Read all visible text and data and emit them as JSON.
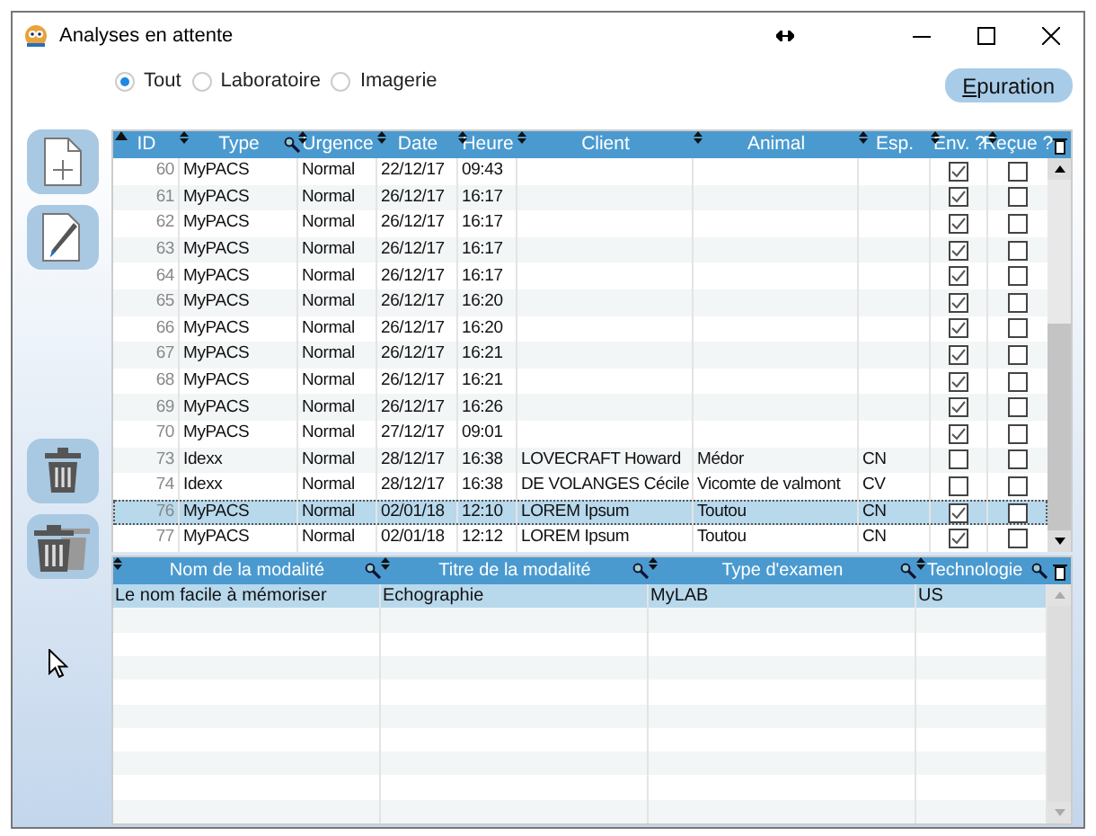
{
  "window": {
    "title": "Analyses en attente"
  },
  "filters": [
    {
      "label": "Tout",
      "selected": true
    },
    {
      "label": "Laboratoire",
      "selected": false
    },
    {
      "label": "Imagerie",
      "selected": false
    }
  ],
  "purge_button": "Epuration",
  "table": {
    "columns": [
      "ID",
      "Type",
      "Urgence",
      "Date",
      "Heure",
      "Client",
      "Animal",
      "Esp.",
      "Env. ?",
      "Reçue ?"
    ],
    "rows": [
      {
        "id": "60",
        "type": "MyPACS",
        "urgence": "Normal",
        "date": "22/12/17",
        "heure": "09:43",
        "env": true,
        "recue": false,
        "selected": false
      },
      {
        "id": "61",
        "type": "MyPACS",
        "urgence": "Normal",
        "date": "26/12/17",
        "heure": "16:17",
        "env": true,
        "recue": false,
        "selected": false
      },
      {
        "id": "62",
        "type": "MyPACS",
        "urgence": "Normal",
        "date": "26/12/17",
        "heure": "16:17",
        "env": true,
        "recue": false,
        "selected": false
      },
      {
        "id": "63",
        "type": "MyPACS",
        "urgence": "Normal",
        "date": "26/12/17",
        "heure": "16:17",
        "env": true,
        "recue": false,
        "selected": false
      },
      {
        "id": "64",
        "type": "MyPACS",
        "urgence": "Normal",
        "date": "26/12/17",
        "heure": "16:17",
        "env": true,
        "recue": false,
        "selected": false
      },
      {
        "id": "65",
        "type": "MyPACS",
        "urgence": "Normal",
        "date": "26/12/17",
        "heure": "16:20",
        "env": true,
        "recue": false,
        "selected": false
      },
      {
        "id": "66",
        "type": "MyPACS",
        "urgence": "Normal",
        "date": "26/12/17",
        "heure": "16:20",
        "env": true,
        "recue": false,
        "selected": false
      },
      {
        "id": "67",
        "type": "MyPACS",
        "urgence": "Normal",
        "date": "26/12/17",
        "heure": "16:21",
        "env": true,
        "recue": false,
        "selected": false
      },
      {
        "id": "68",
        "type": "MyPACS",
        "urgence": "Normal",
        "date": "26/12/17",
        "heure": "16:21",
        "env": true,
        "recue": false,
        "selected": false
      },
      {
        "id": "69",
        "type": "MyPACS",
        "urgence": "Normal",
        "date": "26/12/17",
        "heure": "16:26",
        "env": true,
        "recue": false,
        "selected": false
      },
      {
        "id": "70",
        "type": "MyPACS",
        "urgence": "Normal",
        "date": "27/12/17",
        "heure": "09:01",
        "env": true,
        "recue": false,
        "selected": false
      },
      {
        "id": "73",
        "type": "Idexx",
        "urgence": "Normal",
        "date": "28/12/17",
        "heure": "16:38",
        "client": "LOVECRAFT Howard",
        "animal": "Médor",
        "esp": "CN",
        "env": false,
        "recue": false,
        "selected": false
      },
      {
        "id": "74",
        "type": "Idexx",
        "urgence": "Normal",
        "date": "28/12/17",
        "heure": "16:38",
        "client": "DE VOLANGES Cécile",
        "animal": "Vicomte de valmont",
        "esp": "CV",
        "env": false,
        "recue": false,
        "selected": false
      },
      {
        "id": "76",
        "type": "MyPACS",
        "urgence": "Normal",
        "date": "02/01/18",
        "heure": "12:10",
        "client": "LOREM Ipsum",
        "animal": "Toutou",
        "esp": "CN",
        "env": true,
        "recue": false,
        "selected": true
      },
      {
        "id": "77",
        "type": "MyPACS",
        "urgence": "Normal",
        "date": "02/01/18",
        "heure": "12:12",
        "client": "LOREM Ipsum",
        "animal": "Toutou",
        "esp": "CN",
        "env": true,
        "recue": false,
        "selected": false
      }
    ]
  },
  "modality_table": {
    "columns": [
      "Nom de la modalité",
      "Titre de la modalité",
      "Type d'examen",
      "Technologie"
    ],
    "rows": [
      {
        "cells": [
          "Le nom facile à mémoriser",
          "Echographie",
          "MyLAB",
          "US"
        ],
        "selected": true
      }
    ]
  }
}
